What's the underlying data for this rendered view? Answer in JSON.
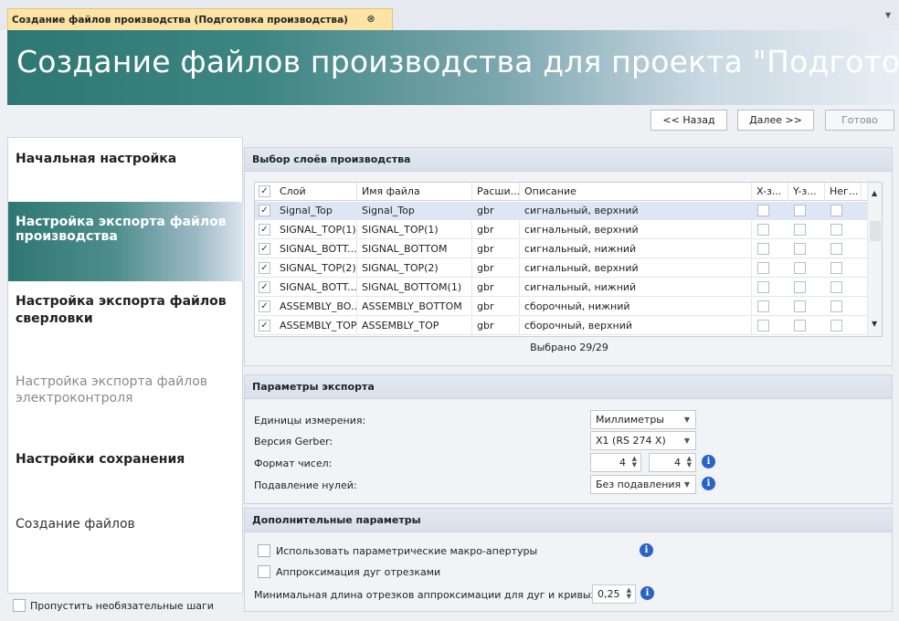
{
  "tab": {
    "title": "Создание файлов производства (Подготовка производства)"
  },
  "banner": {
    "title": "Создание файлов производства для проекта \"Подготовка производства\""
  },
  "wizard": {
    "back": "<< Назад",
    "next": "Далее >>",
    "done": "Готово"
  },
  "nav": {
    "items": [
      {
        "label": "Начальная настройка"
      },
      {
        "label": "Настройка экспорта файлов производства"
      },
      {
        "label": "Настройка экспорта файлов сверловки"
      },
      {
        "label": "Настройка экспорта файлов электроконтроля"
      },
      {
        "label": "Настройки сохранения"
      },
      {
        "label": "Создание файлов"
      }
    ],
    "skip_label": "Пропустить необязательные шаги"
  },
  "layers": {
    "header": "Выбор слоёв производства",
    "columns": [
      "Слой",
      "Имя файла",
      "Расши...",
      "Описание",
      "X-з...",
      "Y-з...",
      "Нег..."
    ],
    "rows": [
      {
        "layer": "Signal_Top",
        "file": "Signal_Top",
        "ext": "gbr",
        "desc": "сигнальный, верхний"
      },
      {
        "layer": "SIGNAL_TOP(1)",
        "file": "SIGNAL_TOP(1)",
        "ext": "gbr",
        "desc": "сигнальный, верхний"
      },
      {
        "layer": "SIGNAL_BOTT...",
        "file": "SIGNAL_BOTTOM",
        "ext": "gbr",
        "desc": "сигнальный, нижний"
      },
      {
        "layer": "SIGNAL_TOP(2)",
        "file": "SIGNAL_TOP(2)",
        "ext": "gbr",
        "desc": "сигнальный, верхний"
      },
      {
        "layer": "SIGNAL_BOTT...",
        "file": "SIGNAL_BOTTOM(1)",
        "ext": "gbr",
        "desc": "сигнальный, нижний"
      },
      {
        "layer": "ASSEMBLY_BO...",
        "file": "ASSEMBLY_BOTTOM",
        "ext": "gbr",
        "desc": "сборочный, нижний"
      },
      {
        "layer": "ASSEMBLY_TOP",
        "file": "ASSEMBLY_TOP",
        "ext": "gbr",
        "desc": "сборочный, верхний"
      }
    ],
    "selected_text": "Выбрано 29/29"
  },
  "export": {
    "header": "Параметры экспорта",
    "units_label": "Единицы измерения:",
    "units_value": "Миллиметры",
    "gerber_label": "Версия Gerber:",
    "gerber_value": "X1 (RS 274 X)",
    "format_label": "Формат чисел:",
    "format_int": "4",
    "format_dec": "4",
    "zeros_label": "Подавление нулей:",
    "zeros_value": "Без подавления"
  },
  "extra": {
    "header": "Дополнительные параметры",
    "macro_label": "Использовать параметрические макро-апертуры",
    "arc_label": "Аппроксимация дуг отрезками",
    "minlen_label": "Минимальная длина отрезков аппроксимации для дуг и кривых Безье:",
    "minlen_value": "0,25"
  },
  "colors": {
    "accent": "#2e7772",
    "tab_bg": "#fde4a5",
    "info": "#2a62c5"
  },
  "icons": {
    "pin": "pin-icon",
    "close": "close-icon",
    "info": "info-icon"
  }
}
